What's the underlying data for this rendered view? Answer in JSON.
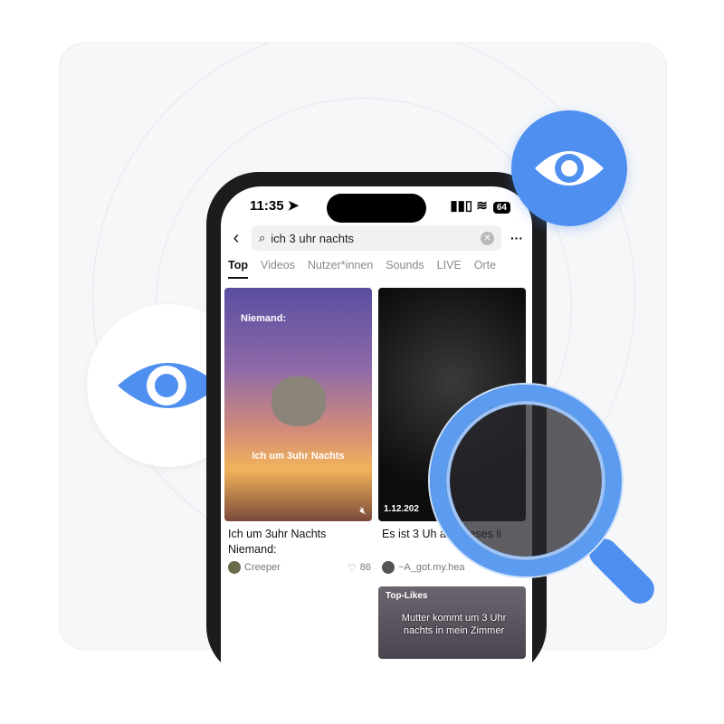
{
  "status": {
    "time": "11:35",
    "battery": "64"
  },
  "search": {
    "query": "ich 3 uhr nachts"
  },
  "tabs": [
    {
      "label": "Top",
      "active": true
    },
    {
      "label": "Videos"
    },
    {
      "label": "Nutzer*innen"
    },
    {
      "label": "Sounds"
    },
    {
      "label": "LIVE"
    },
    {
      "label": "Orte"
    }
  ],
  "results": [
    {
      "overlay_top": "Niemand:",
      "overlay_bottom": "Ich um 3uhr Nachts",
      "title": "Ich um 3uhr Nachts Niemand:",
      "author": "Creeper",
      "likes": "86"
    },
    {
      "date": "1.12.202",
      "title": "Es ist 3 Uh auf Dieses li",
      "author": "~A_got.my.hea"
    },
    {
      "badge": "Top-Likes",
      "overlay": "Mutter kommt um 3 Uhr nachts in mein Zimmer"
    }
  ],
  "colors": {
    "accent": "#4f8ff0",
    "card_bg": "#f6f7f9"
  }
}
